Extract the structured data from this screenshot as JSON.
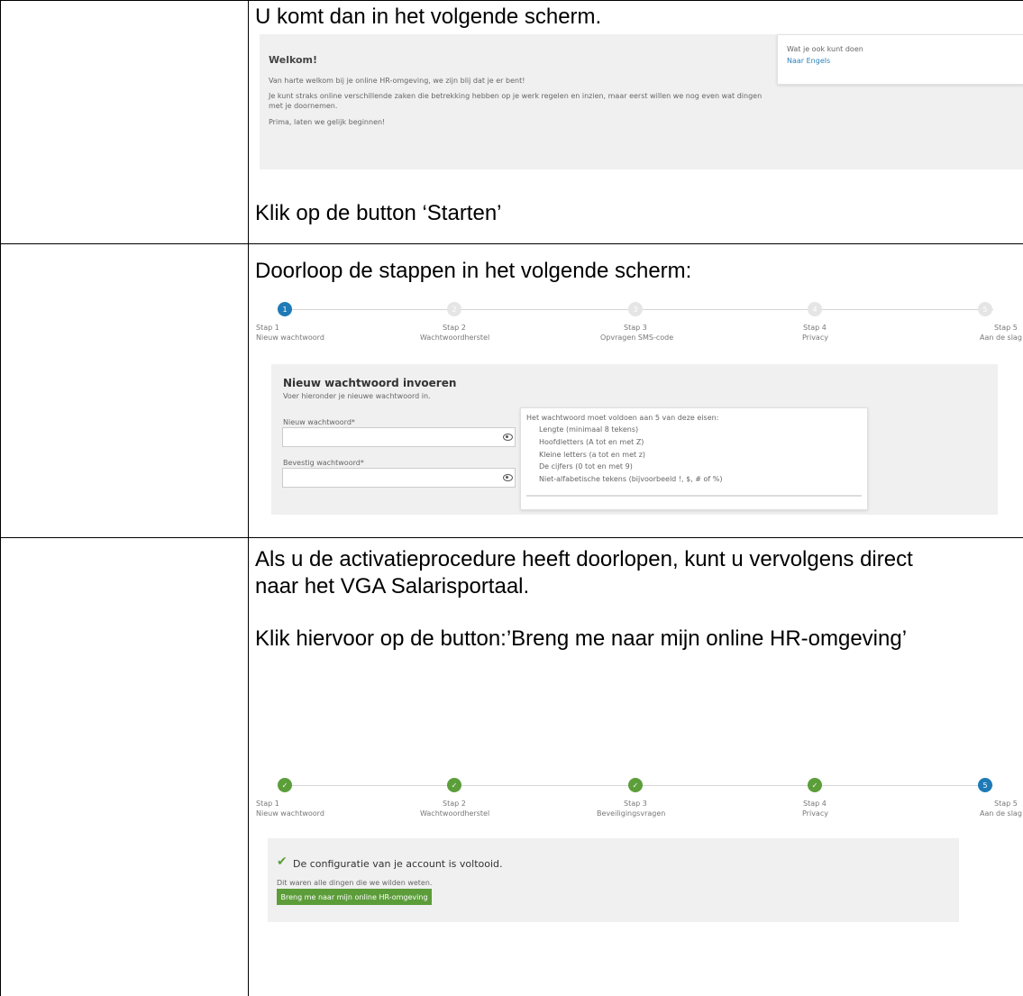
{
  "instructions": {
    "row1_top": "U komt dan in het volgende scherm.",
    "row1_bottom": "Klik op de button ‘Starten’",
    "row2_top": "Doorloop de stappen in het volgende scherm:",
    "row3_line1": "Als u de activatieprocedure heeft doorlopen, kunt u vervolgens direct",
    "row3_line2": "naar het VGA Salarisportaal.",
    "row3_line3": "Klik hiervoor op de button:’Breng me naar mijn online HR-omgeving’"
  },
  "welcome_screen": {
    "title": "Welkom!",
    "para1": "Van harte welkom bij je online HR-omgeving, we zijn blij dat je er bent!",
    "para2a": "Je kunt straks online verschillende zaken die betrekking hebben op je werk regelen en inzien, maar eerst willen we nog even wat dingen",
    "para2b": "met je doornemen.",
    "para3": "Prima, laten we gelijk beginnen!",
    "side_heading": "Wat je ook kunt doen",
    "side_link": "Naar Engels"
  },
  "stepper1": {
    "steps": [
      {
        "num": "1",
        "title": "Stap 1",
        "sub": "Nieuw wachtwoord"
      },
      {
        "num": "2",
        "title": "Stap 2",
        "sub": "Wachtwoordherstel"
      },
      {
        "num": "3",
        "title": "Stap 3",
        "sub": "Opvragen SMS-code"
      },
      {
        "num": "4",
        "title": "Stap 4",
        "sub": "Privacy"
      },
      {
        "num": "5",
        "title": "Stap 5",
        "sub": "Aan de slag"
      }
    ]
  },
  "password_form": {
    "title": "Nieuw wachtwoord invoeren",
    "subtitle": "Voer hieronder je nieuwe wachtwoord in.",
    "field1_label": "Nieuw wachtwoord*",
    "field2_label": "Bevestig wachtwoord*",
    "req_heading": "Het wachtwoord moet voldoen aan 5 van deze eisen:",
    "req_1": "Lengte (minimaal 8 tekens)",
    "req_2": "Hoofdletters (A tot en met Z)",
    "req_3": "Kleine letters (a tot en met z)",
    "req_4": "De cijfers (0 tot en met 9)",
    "req_5": "Niet-alfabetische tekens (bijvoorbeeld !, $, # of %)"
  },
  "stepper2": {
    "steps": [
      {
        "num": "",
        "title": "Stap 1",
        "sub": "Nieuw wachtwoord"
      },
      {
        "num": "",
        "title": "Stap 2",
        "sub": "Wachtwoordherstel"
      },
      {
        "num": "",
        "title": "Stap 3",
        "sub": "Beveiligingsvragen"
      },
      {
        "num": "",
        "title": "Stap 4",
        "sub": "Privacy"
      },
      {
        "num": "5",
        "title": "Stap 5",
        "sub": "Aan de slag"
      }
    ]
  },
  "done_screen": {
    "title": "De configuratie van je account is voltooid.",
    "subtitle": "Dit waren alle dingen die we wilden weten.",
    "button": "Breng me naar mijn online HR-omgeving"
  },
  "colors": {
    "active_step": "#1f7ab6",
    "done_step": "#5b9e3a",
    "button_green": "#5c9d3a",
    "link_blue": "#2a82b8"
  }
}
